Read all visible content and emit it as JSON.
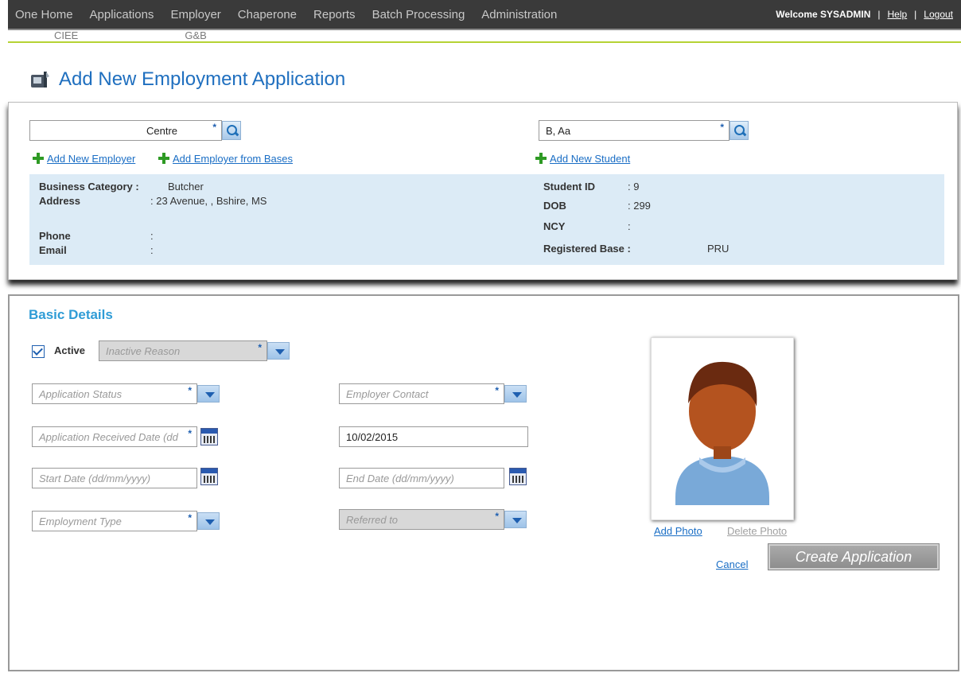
{
  "nav": {
    "items": [
      "One Home",
      "Applications",
      "Employer",
      "Chaperone",
      "Reports",
      "Batch Processing",
      "Administration"
    ],
    "welcome": "Welcome",
    "username": "SYSADMIN",
    "help": "Help",
    "logout": "Logout"
  },
  "subnav": {
    "items": [
      "CIEE",
      "G&B"
    ]
  },
  "page": {
    "title": "Add New Employment Application"
  },
  "employer": {
    "search_value": "Centre",
    "add_new": "Add New Employer",
    "add_from_bases": "Add Employer from Bases",
    "business_category_label": "Business Category :",
    "business_category_value": "Butcher",
    "address_label": "Address",
    "address_value": ": 23 Avenue, , Bshire, MS",
    "phone_label": "Phone",
    "phone_value": ":",
    "email_label": "Email",
    "email_value": ":"
  },
  "student": {
    "search_value": "B, Aa",
    "add_new": "Add New Student",
    "student_id_label": "Student ID",
    "student_id_value": ": 9",
    "dob_label": "DOB",
    "dob_value": ": 299",
    "ncy_label": "NCY",
    "ncy_value": ":",
    "registered_base_label": "Registered Base :",
    "registered_base_value": "PRU"
  },
  "basic_details": {
    "title": "Basic Details",
    "active_label": "Active",
    "active_checked": true,
    "inactive_reason_placeholder": "Inactive Reason",
    "application_status_placeholder": "Application Status",
    "employer_contact_placeholder": "Employer Contact",
    "application_received_placeholder": "Application Received Date (dd",
    "application_received_value": "10/02/2015",
    "start_date_placeholder": "Start Date (dd/mm/yyyy)",
    "end_date_placeholder": "End Date (dd/mm/yyyy)",
    "employment_type_placeholder": "Employment Type",
    "referred_to_placeholder": "Referred to",
    "add_photo": "Add Photo",
    "delete_photo": "Delete Photo",
    "cancel": "Cancel",
    "create": "Create Application"
  },
  "colors": {
    "accent": "#1f6fbf",
    "nav_bg": "#3a3a3a",
    "subnav_rule": "#b5d334",
    "info_bg": "#dcebf6",
    "section_title": "#2f9cd6"
  }
}
